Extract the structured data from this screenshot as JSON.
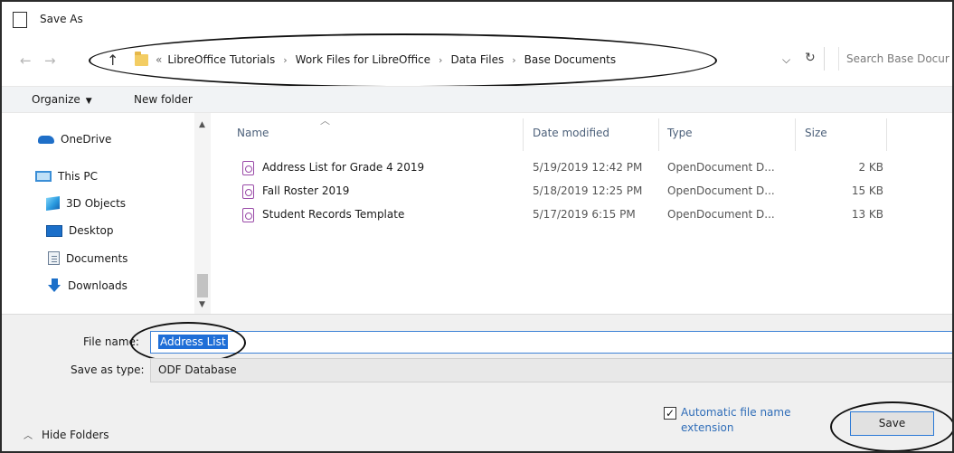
{
  "window": {
    "title": "Save As"
  },
  "address_bar": {
    "prefix": "«",
    "breadcrumbs": [
      "LibreOffice Tutorials",
      "Work Files for LibreOffice",
      "Data Files",
      "Base Documents"
    ],
    "search_placeholder": "Search Base Docur"
  },
  "toolbar": {
    "organize_label": "Organize",
    "new_folder_label": "New folder"
  },
  "nav_pane": {
    "items": [
      {
        "label": "OneDrive",
        "icon": "onedrive-icon"
      },
      {
        "label": "This PC",
        "icon": "pc-icon"
      },
      {
        "label": "3D Objects",
        "icon": "3d-objects-icon"
      },
      {
        "label": "Desktop",
        "icon": "desktop-icon"
      },
      {
        "label": "Documents",
        "icon": "documents-icon"
      },
      {
        "label": "Downloads",
        "icon": "downloads-icon"
      }
    ]
  },
  "file_list": {
    "columns": {
      "name": "Name",
      "date": "Date modified",
      "type": "Type",
      "size": "Size"
    },
    "rows": [
      {
        "name": "Address List for Grade 4 2019",
        "date": "5/19/2019 12:42 PM",
        "type": "OpenDocument D...",
        "size": "2 KB"
      },
      {
        "name": "Fall Roster 2019",
        "date": "5/18/2019 12:25 PM",
        "type": "OpenDocument D...",
        "size": "15 KB"
      },
      {
        "name": "Student Records Template",
        "date": "5/17/2019 6:15 PM",
        "type": "OpenDocument D...",
        "size": "13 KB"
      }
    ]
  },
  "form": {
    "file_name_label": "File name:",
    "file_name_value": "Address List",
    "save_as_type_label": "Save as type:",
    "save_as_type_value": "ODF Database"
  },
  "footer": {
    "hide_folders_label": "Hide Folders",
    "auto_ext_label": "Automatic file name extension",
    "auto_ext_checked": true,
    "save_label": "Save"
  },
  "colors": {
    "accent": "#1e6ed7",
    "link": "#2f6db8",
    "file_icon": "#9a4aa8"
  }
}
